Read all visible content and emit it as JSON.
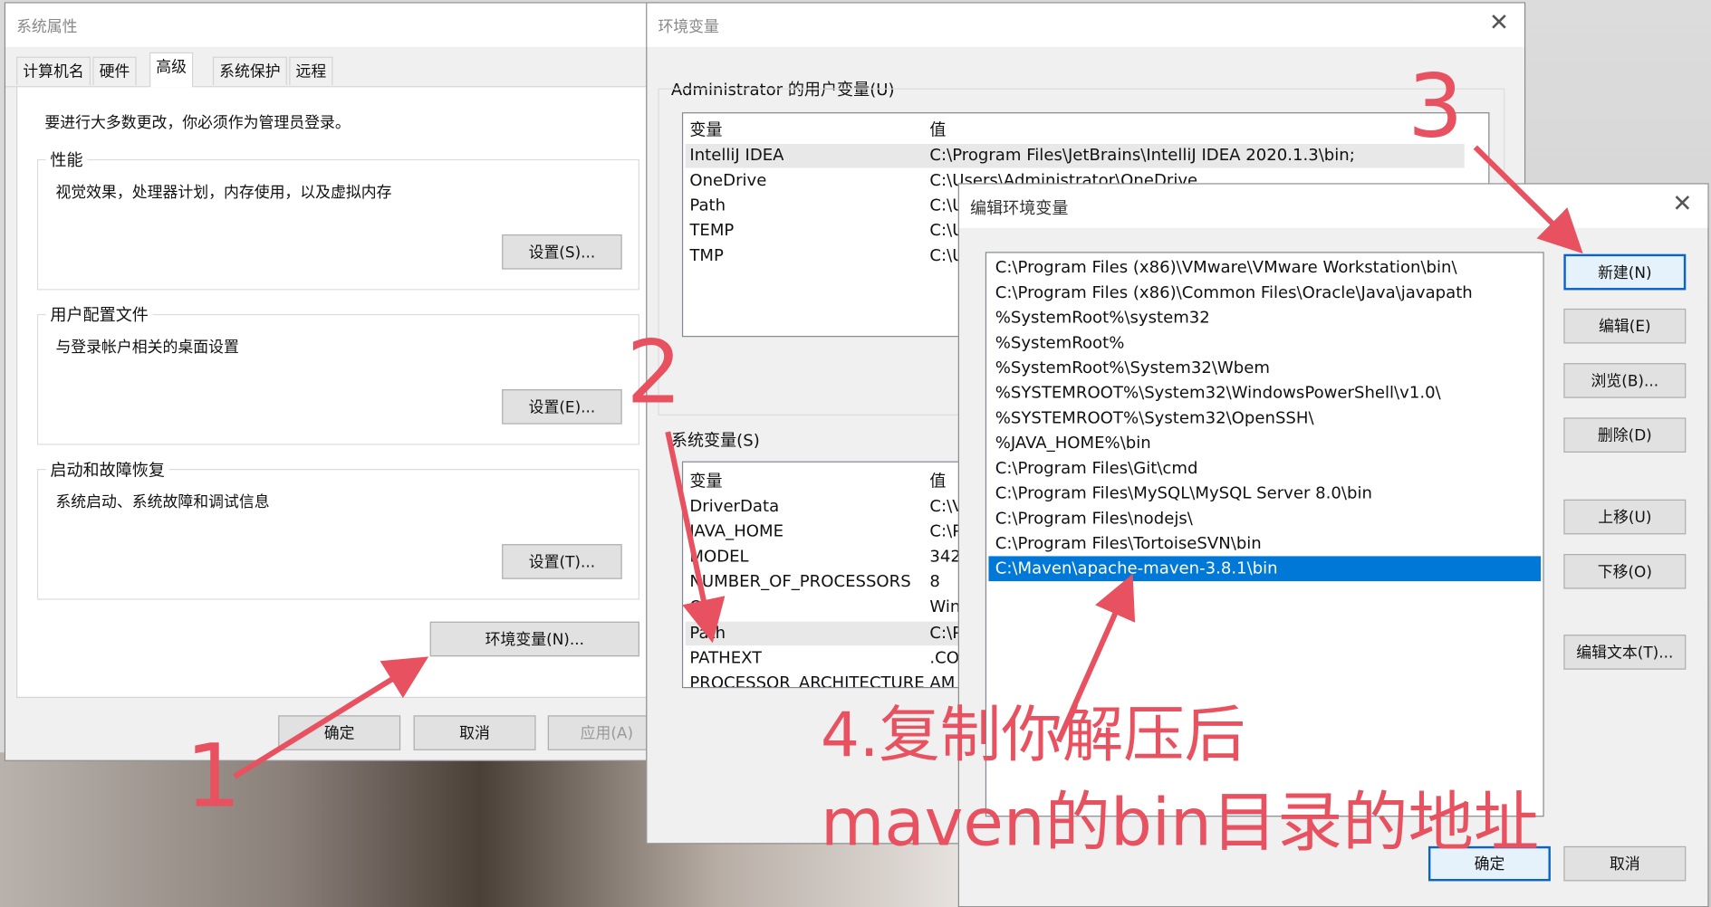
{
  "system_properties": {
    "title": "系统属性",
    "tabs": [
      "计算机名",
      "硬件",
      "高级",
      "系统保护",
      "远程"
    ],
    "admin_notice": "要进行大多数更改，你必须作为管理员登录。",
    "performance": {
      "label": "性能",
      "desc": "视觉效果，处理器计划，内存使用，以及虚拟内存",
      "button": "设置(S)..."
    },
    "user_profiles": {
      "label": "用户配置文件",
      "desc": "与登录帐户相关的桌面设置",
      "button": "设置(E)..."
    },
    "startup": {
      "label": "启动和故障恢复",
      "desc": "系统启动、系统故障和调试信息",
      "button": "设置(T)..."
    },
    "env_button": "环境变量(N)...",
    "ok": "确定",
    "cancel": "取消",
    "apply": "应用(A)"
  },
  "env_vars": {
    "title": "环境变量",
    "user_section": "Administrator 的用户变量(U)",
    "col_var": "变量",
    "col_val": "值",
    "user_rows": [
      {
        "name": "IntelliJ IDEA",
        "value": "C:\\Program Files\\JetBrains\\IntelliJ IDEA 2020.1.3\\bin;"
      },
      {
        "name": "OneDrive",
        "value": "C:\\Users\\Administrator\\OneDrive"
      },
      {
        "name": "Path",
        "value": "C:\\U"
      },
      {
        "name": "TEMP",
        "value": "C:\\U"
      },
      {
        "name": "TMP",
        "value": "C:\\U"
      }
    ],
    "system_section": "系统变量(S)",
    "system_rows": [
      {
        "name": "DriverData",
        "value": "C:\\V"
      },
      {
        "name": "JAVA_HOME",
        "value": "C:\\P"
      },
      {
        "name": "MODEL",
        "value": "342"
      },
      {
        "name": "NUMBER_OF_PROCESSORS",
        "value": "8"
      },
      {
        "name": "OS",
        "value": "Win"
      },
      {
        "name": "Path",
        "value": "C:\\P"
      },
      {
        "name": "PATHEXT",
        "value": ".CO"
      },
      {
        "name": "PROCESSOR_ARCHITECTURE",
        "value": "AM"
      }
    ]
  },
  "edit_env": {
    "title": "编辑环境变量",
    "items": [
      "C:\\Program Files (x86)\\VMware\\VMware Workstation\\bin\\",
      "C:\\Program Files (x86)\\Common Files\\Oracle\\Java\\javapath",
      "%SystemRoot%\\system32",
      "%SystemRoot%",
      "%SystemRoot%\\System32\\Wbem",
      "%SYSTEMROOT%\\System32\\WindowsPowerShell\\v1.0\\",
      "%SYSTEMROOT%\\System32\\OpenSSH\\",
      "%JAVA_HOME%\\bin",
      "C:\\Program Files\\Git\\cmd",
      "C:\\Program Files\\MySQL\\MySQL Server 8.0\\bin",
      "C:\\Program Files\\nodejs\\",
      "C:\\Program Files\\TortoiseSVN\\bin",
      "C:\\Maven\\apache-maven-3.8.1\\bin"
    ],
    "selected_index": 12,
    "buttons": {
      "new": "新建(N)",
      "edit": "编辑(E)",
      "browse": "浏览(B)...",
      "delete": "删除(D)",
      "move_up": "上移(U)",
      "move_down": "下移(O)",
      "edit_text": "编辑文本(T)...",
      "ok": "确定",
      "cancel": "取消"
    }
  },
  "annotations": {
    "step1": "1",
    "step2": "2",
    "step3": "3",
    "step4_line1": "4.复制你解压后",
    "step4_line2": "maven的bin目录的地址"
  },
  "colors": {
    "annotation": "#e8515f",
    "selection": "#0078d7",
    "primary_border": "#0a64c8"
  }
}
